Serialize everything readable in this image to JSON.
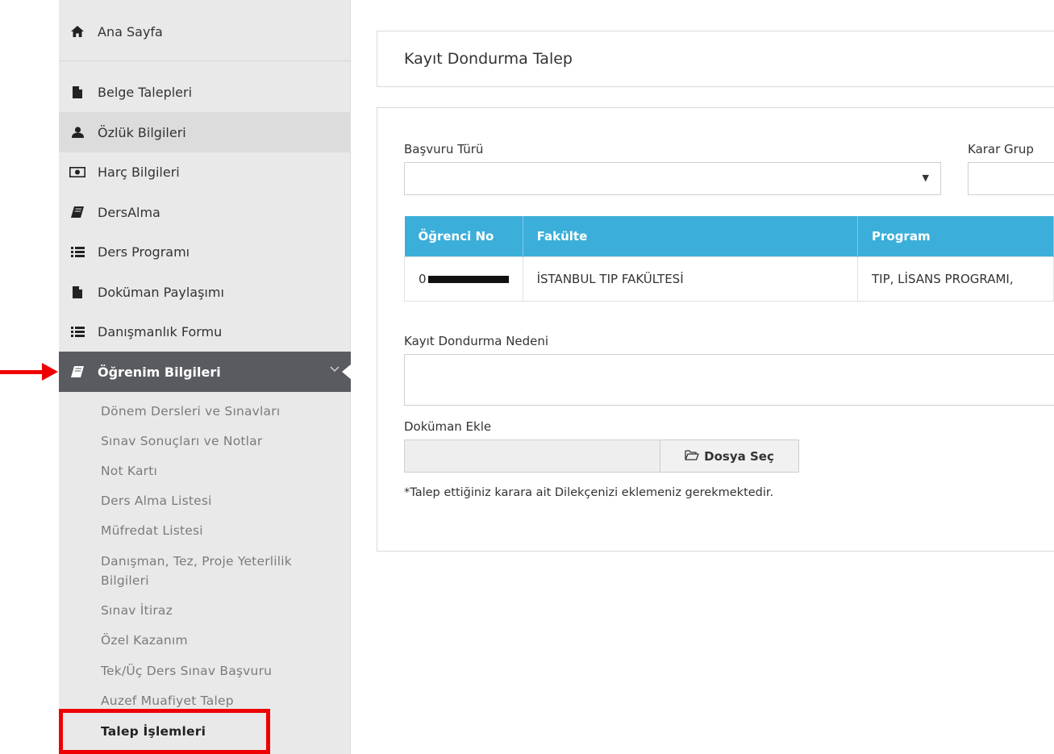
{
  "sidebar": {
    "items": [
      {
        "label": "Ana Sayfa",
        "icon": "home-icon"
      },
      {
        "label": "Belge Talepleri",
        "icon": "file-icon"
      },
      {
        "label": "Özlük Bilgileri",
        "icon": "user-icon"
      },
      {
        "label": "Harç Bilgileri",
        "icon": "money-icon"
      },
      {
        "label": "DersAlma",
        "icon": "book-icon"
      },
      {
        "label": "Ders Programı",
        "icon": "list-icon"
      },
      {
        "label": "Doküman Paylaşımı",
        "icon": "file-icon"
      },
      {
        "label": "Danışmanlık Formu",
        "icon": "list-icon"
      },
      {
        "label": "Öğrenim Bilgileri",
        "icon": "book-icon"
      }
    ],
    "sub_items": [
      "Dönem Dersleri ve Sınavları",
      "Sınav Sonuçları ve Notlar",
      "Not Kartı",
      "Ders Alma Listesi",
      "Müfredat Listesi",
      "Danışman, Tez, Proje Yeterlilik Bilgileri",
      "Sınav İtiraz",
      "Özel Kazanım",
      "Tek/Üç Ders Sınav Başvuru",
      "Auzef Muafiyet Talep",
      "Talep İşlemleri"
    ]
  },
  "page": {
    "title": "Kayıt Dondurma Talep"
  },
  "form": {
    "basvuru_turu_label": "Başvuru Türü",
    "basvuru_turu_value": "",
    "karar_grup_label": "Karar Grup",
    "table": {
      "headers": [
        "Öğrenci No",
        "Fakülte",
        "Program"
      ],
      "rows": [
        {
          "ogrenci_no": "0",
          "fakulte": "İSTANBUL TIP FAKÜLTESİ",
          "program": "TIP, LİSANS PROGRAMI,"
        }
      ]
    },
    "neden_label": "Kayıt Dondurma Nedeni",
    "dokuman_label": "Doküman Ekle",
    "file_button": "Dosya Seç",
    "note": "*Talep ettiğiniz karara ait Dilekçenizi eklemeniz gerekmektedir."
  },
  "colors": {
    "accent": "#3bafd9",
    "active_nav": "#595b60",
    "annotation": "#ee0000"
  }
}
